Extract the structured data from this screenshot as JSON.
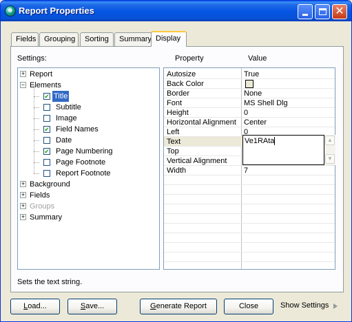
{
  "window": {
    "title": "Report Properties"
  },
  "tabs": [
    {
      "label": "Fields",
      "active": false
    },
    {
      "label": "Grouping",
      "active": false
    },
    {
      "label": "Sorting",
      "active": false
    },
    {
      "label": "Summary",
      "active": false
    },
    {
      "label": "Display",
      "active": true
    }
  ],
  "settings": {
    "label": "Settings:",
    "tree": [
      {
        "label": "Report",
        "type": "group",
        "expander": "+"
      },
      {
        "label": "Elements",
        "type": "group",
        "expander": "-"
      },
      {
        "label": "Title",
        "type": "check",
        "checked": true,
        "selected": true
      },
      {
        "label": "Subtitle",
        "type": "check",
        "checked": false
      },
      {
        "label": "Image",
        "type": "check",
        "checked": false
      },
      {
        "label": "Field Names",
        "type": "check",
        "checked": true
      },
      {
        "label": "Date",
        "type": "check",
        "checked": false
      },
      {
        "label": "Page Numbering",
        "type": "check",
        "checked": true
      },
      {
        "label": "Page Footnote",
        "type": "check",
        "checked": false
      },
      {
        "label": "Report Footnote",
        "type": "check",
        "checked": false
      },
      {
        "label": "Background",
        "type": "group",
        "expander": "+"
      },
      {
        "label": "Fields",
        "type": "group",
        "expander": "+"
      },
      {
        "label": "Groups",
        "type": "group",
        "expander": "+",
        "disabled": true
      },
      {
        "label": "Summary",
        "type": "group",
        "expander": "+"
      }
    ]
  },
  "property_grid": {
    "header_property": "Property",
    "header_value": "Value",
    "rows": [
      {
        "property": "Autosize",
        "value": "True"
      },
      {
        "property": "Back Color",
        "value": "",
        "swatch": "#ece9d8"
      },
      {
        "property": "Border",
        "value": "None"
      },
      {
        "property": "Font",
        "value": "MS Shell Dlg"
      },
      {
        "property": "Height",
        "value": "0"
      },
      {
        "property": "Horizontal Alignment",
        "value": "Center"
      },
      {
        "property": "Left",
        "value": "0"
      },
      {
        "property": "Text",
        "value": "Ve1RAta",
        "editing": true
      },
      {
        "property": "Top",
        "value": ""
      },
      {
        "property": "Vertical Alignment",
        "value": ""
      },
      {
        "property": "Width",
        "value": "7"
      }
    ],
    "editor_value": "Ve1RAta"
  },
  "status_text": "Sets the text string.",
  "buttons": {
    "load": {
      "mnemonic": "L",
      "rest": "oad..."
    },
    "save": {
      "mnemonic": "S",
      "rest": "ave..."
    },
    "generate": {
      "mnemonic": "G",
      "rest": "enerate Report"
    },
    "close": "Close",
    "show_settings": "Show Settings"
  },
  "colors": {
    "titlebar": "#0554e3",
    "selection": "#316ac5",
    "tab_highlight": "#ffc83c"
  }
}
